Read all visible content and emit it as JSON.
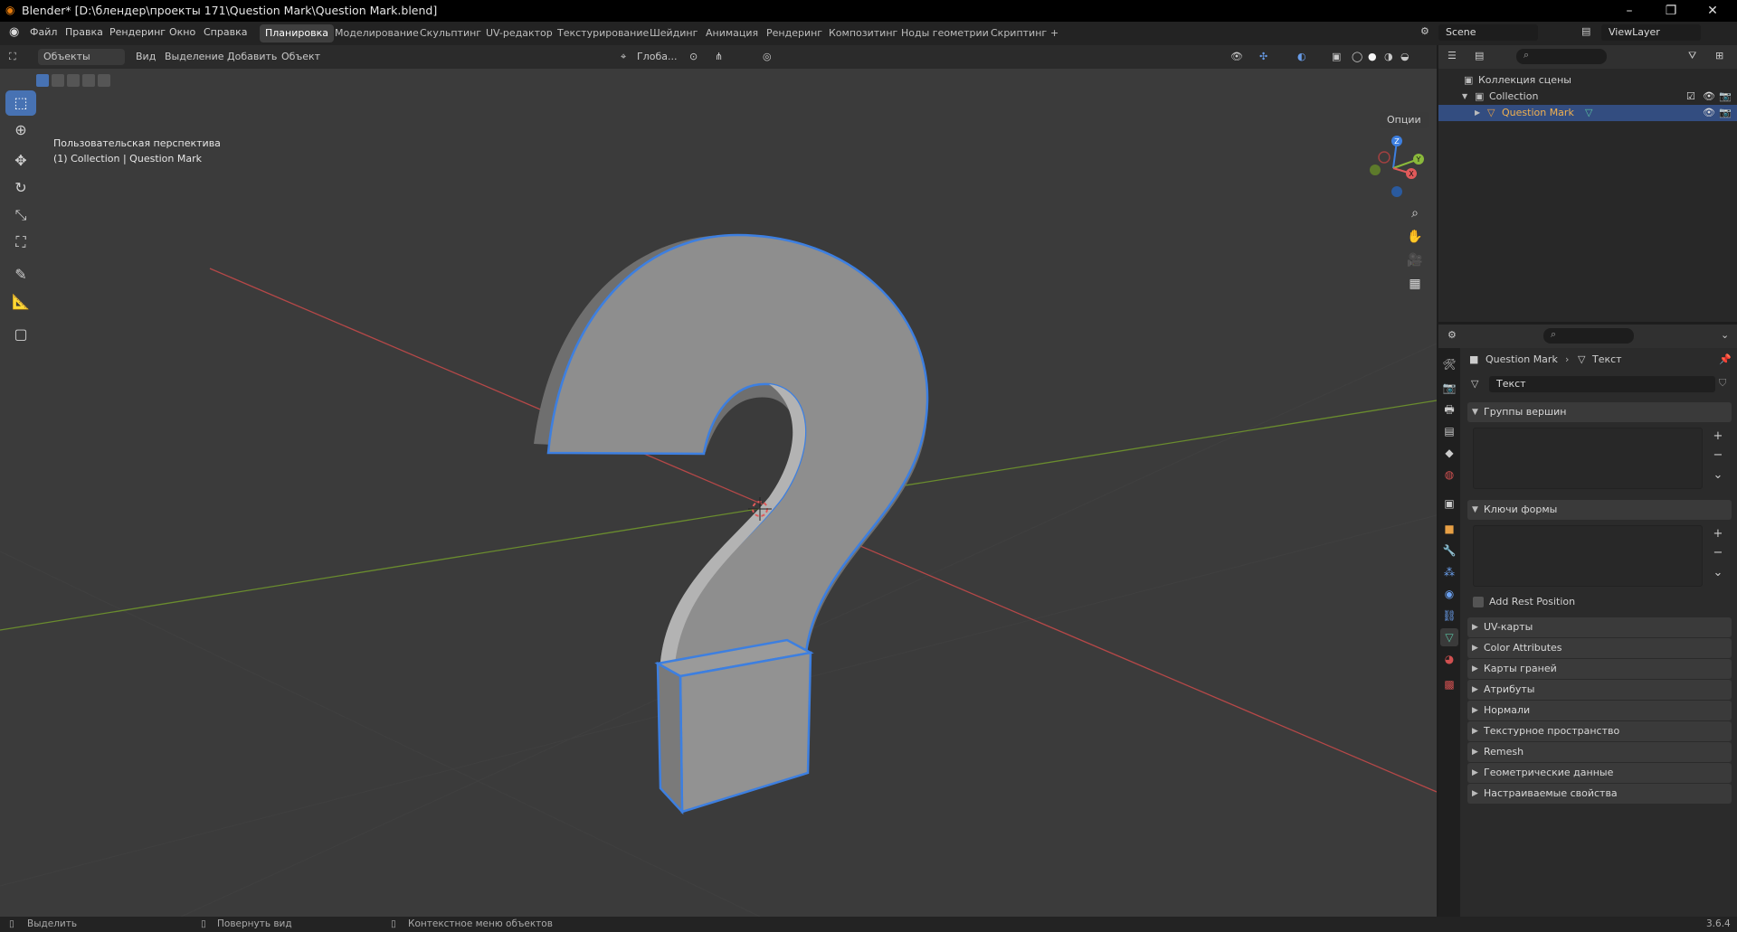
{
  "titlebar": {
    "title": "Blender* [D:\\блендер\\проекты 171\\Question Mark\\Question Mark.blend]",
    "min": "–",
    "max": "❐",
    "close": "✕"
  },
  "menus": [
    "Файл",
    "Правка",
    "Рендеринг",
    "Окно",
    "Справка"
  ],
  "workspaces": [
    "Планировка",
    "Моделирование",
    "Скульптинг",
    "UV-редактор",
    "Текстурирование",
    "Шейдинг",
    "Анимация",
    "Рендеринг",
    "Композитинг",
    "Ноды геометрии",
    "Скриптинг",
    "+"
  ],
  "scene": {
    "name": "Scene",
    "viewlayer": "ViewLayer"
  },
  "viewport": {
    "mode": "Объекты",
    "menu": [
      "Вид",
      "Выделение",
      "Добавить",
      "Объект"
    ],
    "orientation": "Глоба...",
    "options": "Опции",
    "info_line1": "Пользовательская перспектива",
    "info_line2": "(1) Collection | Question Mark",
    "gizmo": {
      "x": "X",
      "y": "Y",
      "z": "Z"
    }
  },
  "outliner": {
    "rows": [
      {
        "label": "Коллекция сцены"
      },
      {
        "label": "Collection"
      },
      {
        "label": "Question Mark"
      }
    ]
  },
  "properties": {
    "breadcrumb_obj": "Question Mark",
    "breadcrumb_data": "Текст",
    "datablock": "Текст",
    "vgroups": "Группы вершин",
    "shapekeys": "Ключи формы",
    "rest": "Add Rest Position",
    "panels": [
      "UV-карты",
      "Color Attributes",
      "Карты граней",
      "Атрибуты",
      "Нормали",
      "Текстурное пространство",
      "Remesh",
      "Геометрические данные",
      "Настраиваемые свойства"
    ]
  },
  "status": {
    "select": "Выделить",
    "rotate": "Повернуть вид",
    "context": "Контекстное меню объектов",
    "version": "3.6.4"
  },
  "colors": {
    "accent": "#4772b3",
    "selection_outline": "#3d7fe0",
    "x_axis": "#b54848",
    "y_axis": "#6a8c2e"
  }
}
